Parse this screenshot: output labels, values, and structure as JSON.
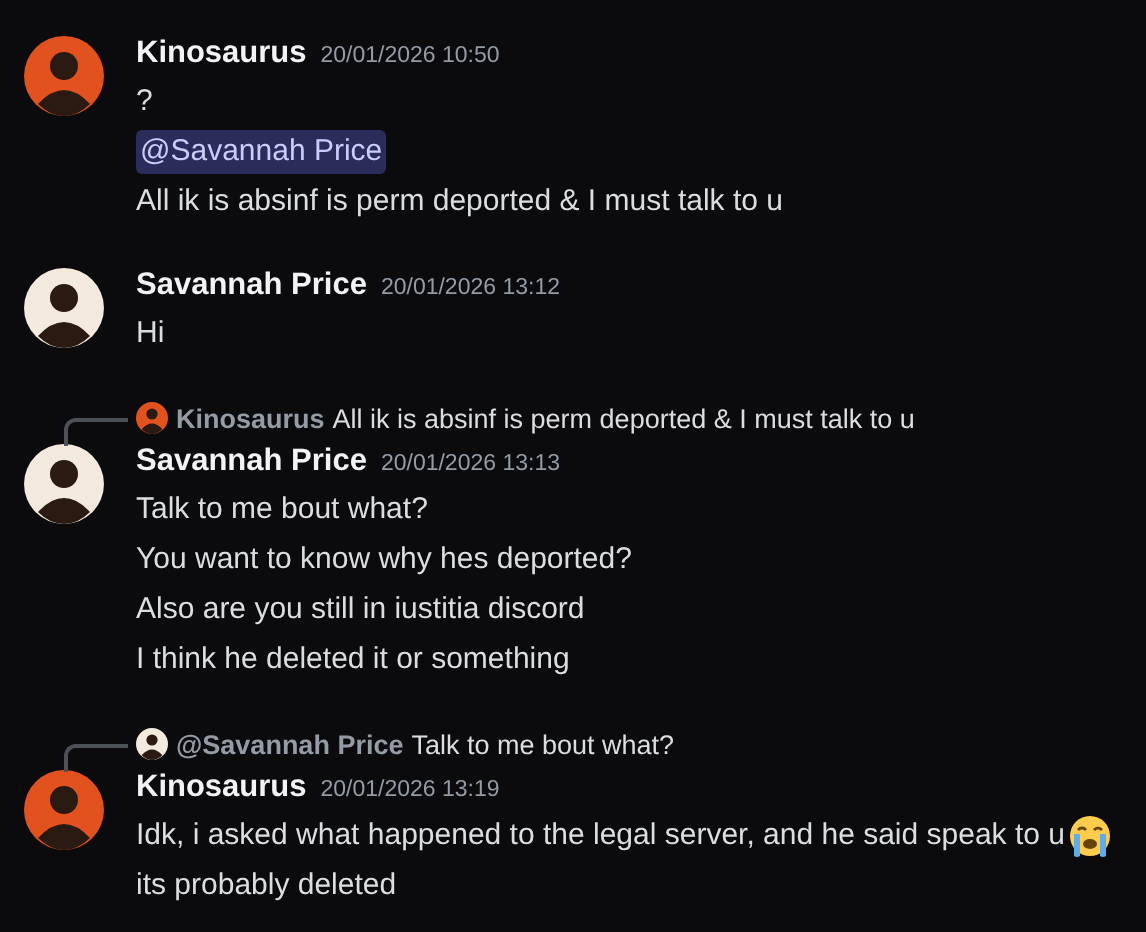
{
  "messages": [
    {
      "author": "Kinosaurus",
      "color": "#e2521e",
      "time": "20/01/2026 10:50",
      "lines": [
        {
          "kind": "text",
          "text": "?"
        },
        {
          "kind": "mention",
          "text": "@Savannah Price"
        },
        {
          "kind": "text",
          "text": "All ik is absinf is perm deported & I must talk to u"
        }
      ]
    },
    {
      "author": "Savannah Price",
      "color": "#f3e9dc",
      "time": "20/01/2026 13:12",
      "lines": [
        {
          "kind": "text",
          "text": "Hi"
        }
      ]
    },
    {
      "reply": {
        "author": "Kinosaurus",
        "color": "#e2521e",
        "text": "All ik is absinf is perm deported & I must talk to u"
      },
      "author": "Savannah Price",
      "color": "#f3e9dc",
      "time": "20/01/2026 13:13",
      "lines": [
        {
          "kind": "text",
          "text": "Talk to me bout what?"
        },
        {
          "kind": "text",
          "text": "You want to know why hes deported?"
        },
        {
          "kind": "text",
          "text": "Also are you still in iustitia discord"
        },
        {
          "kind": "text",
          "text": "I think he deleted it or something"
        }
      ]
    },
    {
      "reply": {
        "author": "@Savannah Price",
        "color": "#f3e9dc",
        "text": "Talk to me bout what?"
      },
      "author": "Kinosaurus",
      "color": "#e2521e",
      "time": "20/01/2026 13:19",
      "lines": [
        {
          "kind": "text",
          "text": "Idk, i asked what happened to the legal server, and he said speak to u",
          "crying_emoji": true
        },
        {
          "kind": "text",
          "text": "its probably deleted"
        }
      ]
    }
  ]
}
